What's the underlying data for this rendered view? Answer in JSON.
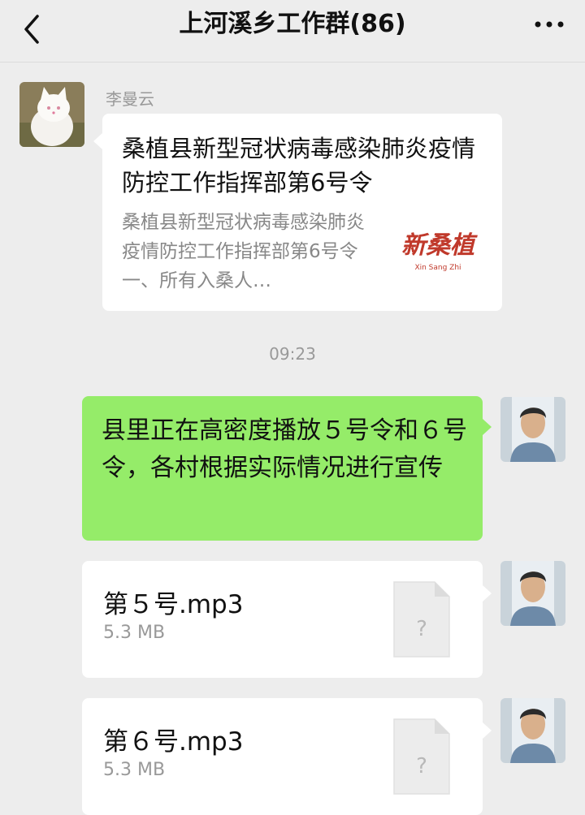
{
  "header": {
    "title": "上河溪乡工作群(86)"
  },
  "messages": {
    "link_card": {
      "sender": "李曼云",
      "title": "桑植县新型冠状病毒感染肺炎疫情防控工作指挥部第6号令",
      "description": " 桑植县新型冠状病毒感染肺炎疫情防控工作指挥部第6号令一、所有入桑人…",
      "thumb_logo_text": "新桑植",
      "thumb_sub_text": "Xin Sang Zhi"
    },
    "timestamp": "09:23",
    "text_message": {
      "text": "县里正在高密度播放５号令和６号令，各村根据实际情况进行宣传"
    },
    "files": [
      {
        "name": "第５号.mp3",
        "size": "5.3 MB"
      },
      {
        "name": "第６号.mp3",
        "size": "5.3 MB"
      }
    ]
  },
  "colors": {
    "background": "#ededed",
    "green_bubble": "#95ec69",
    "white_bubble": "#ffffff",
    "logo_red": "#c0392b"
  },
  "icons": [
    "back-arrow-icon",
    "more-dots-icon",
    "unknown-file-icon"
  ]
}
